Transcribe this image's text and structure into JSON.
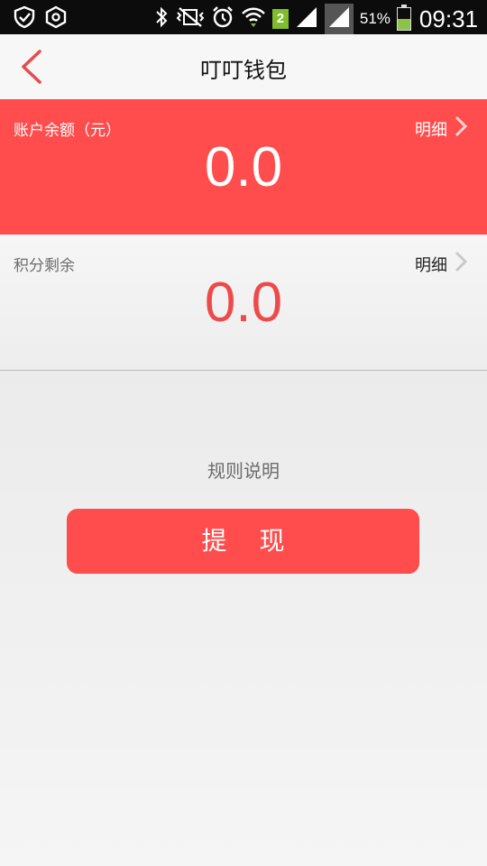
{
  "status_bar": {
    "battery_percent": "51%",
    "time": "09:31",
    "notification_count": "2",
    "battery_level": 0.51
  },
  "header": {
    "title": "叮叮钱包"
  },
  "balance_card": {
    "label": "账户余额（元）",
    "detail_label": "明细",
    "value": "0.0"
  },
  "points_card": {
    "label": "积分剩余",
    "detail_label": "明细",
    "value": "0.0"
  },
  "rules_link": "规则说明",
  "withdraw_button": "提现",
  "colors": {
    "accent": "#ff4c4c",
    "points_value": "#ee4a4a"
  }
}
